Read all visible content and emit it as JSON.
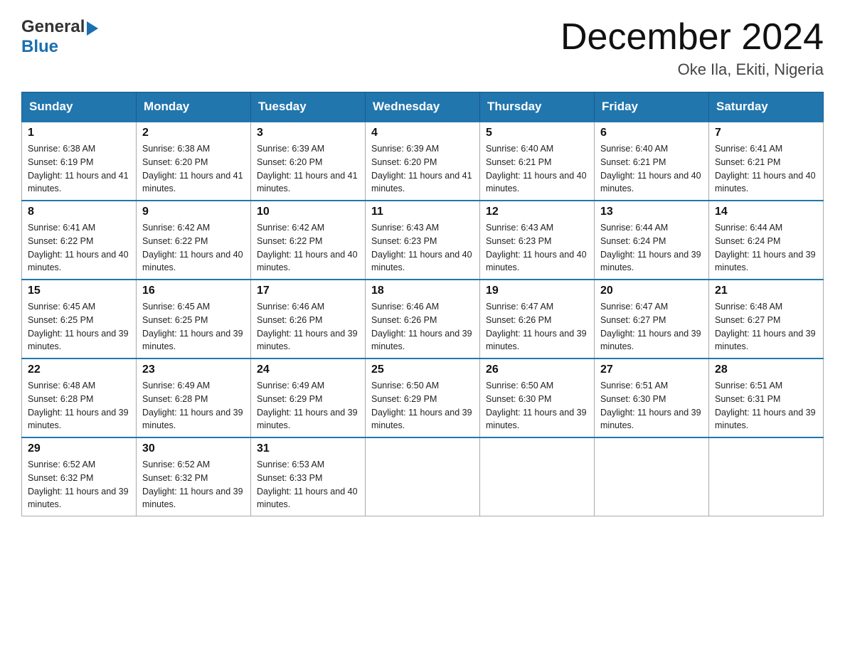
{
  "header": {
    "logo_line1": "General",
    "logo_arrow": "▶",
    "logo_line2": "Blue",
    "month_title": "December 2024",
    "location": "Oke Ila, Ekiti, Nigeria"
  },
  "calendar": {
    "days_of_week": [
      "Sunday",
      "Monday",
      "Tuesday",
      "Wednesday",
      "Thursday",
      "Friday",
      "Saturday"
    ],
    "weeks": [
      [
        {
          "day": "1",
          "sunrise": "6:38 AM",
          "sunset": "6:19 PM",
          "daylight": "11 hours and 41 minutes."
        },
        {
          "day": "2",
          "sunrise": "6:38 AM",
          "sunset": "6:20 PM",
          "daylight": "11 hours and 41 minutes."
        },
        {
          "day": "3",
          "sunrise": "6:39 AM",
          "sunset": "6:20 PM",
          "daylight": "11 hours and 41 minutes."
        },
        {
          "day": "4",
          "sunrise": "6:39 AM",
          "sunset": "6:20 PM",
          "daylight": "11 hours and 41 minutes."
        },
        {
          "day": "5",
          "sunrise": "6:40 AM",
          "sunset": "6:21 PM",
          "daylight": "11 hours and 40 minutes."
        },
        {
          "day": "6",
          "sunrise": "6:40 AM",
          "sunset": "6:21 PM",
          "daylight": "11 hours and 40 minutes."
        },
        {
          "day": "7",
          "sunrise": "6:41 AM",
          "sunset": "6:21 PM",
          "daylight": "11 hours and 40 minutes."
        }
      ],
      [
        {
          "day": "8",
          "sunrise": "6:41 AM",
          "sunset": "6:22 PM",
          "daylight": "11 hours and 40 minutes."
        },
        {
          "day": "9",
          "sunrise": "6:42 AM",
          "sunset": "6:22 PM",
          "daylight": "11 hours and 40 minutes."
        },
        {
          "day": "10",
          "sunrise": "6:42 AM",
          "sunset": "6:22 PM",
          "daylight": "11 hours and 40 minutes."
        },
        {
          "day": "11",
          "sunrise": "6:43 AM",
          "sunset": "6:23 PM",
          "daylight": "11 hours and 40 minutes."
        },
        {
          "day": "12",
          "sunrise": "6:43 AM",
          "sunset": "6:23 PM",
          "daylight": "11 hours and 40 minutes."
        },
        {
          "day": "13",
          "sunrise": "6:44 AM",
          "sunset": "6:24 PM",
          "daylight": "11 hours and 39 minutes."
        },
        {
          "day": "14",
          "sunrise": "6:44 AM",
          "sunset": "6:24 PM",
          "daylight": "11 hours and 39 minutes."
        }
      ],
      [
        {
          "day": "15",
          "sunrise": "6:45 AM",
          "sunset": "6:25 PM",
          "daylight": "11 hours and 39 minutes."
        },
        {
          "day": "16",
          "sunrise": "6:45 AM",
          "sunset": "6:25 PM",
          "daylight": "11 hours and 39 minutes."
        },
        {
          "day": "17",
          "sunrise": "6:46 AM",
          "sunset": "6:26 PM",
          "daylight": "11 hours and 39 minutes."
        },
        {
          "day": "18",
          "sunrise": "6:46 AM",
          "sunset": "6:26 PM",
          "daylight": "11 hours and 39 minutes."
        },
        {
          "day": "19",
          "sunrise": "6:47 AM",
          "sunset": "6:26 PM",
          "daylight": "11 hours and 39 minutes."
        },
        {
          "day": "20",
          "sunrise": "6:47 AM",
          "sunset": "6:27 PM",
          "daylight": "11 hours and 39 minutes."
        },
        {
          "day": "21",
          "sunrise": "6:48 AM",
          "sunset": "6:27 PM",
          "daylight": "11 hours and 39 minutes."
        }
      ],
      [
        {
          "day": "22",
          "sunrise": "6:48 AM",
          "sunset": "6:28 PM",
          "daylight": "11 hours and 39 minutes."
        },
        {
          "day": "23",
          "sunrise": "6:49 AM",
          "sunset": "6:28 PM",
          "daylight": "11 hours and 39 minutes."
        },
        {
          "day": "24",
          "sunrise": "6:49 AM",
          "sunset": "6:29 PM",
          "daylight": "11 hours and 39 minutes."
        },
        {
          "day": "25",
          "sunrise": "6:50 AM",
          "sunset": "6:29 PM",
          "daylight": "11 hours and 39 minutes."
        },
        {
          "day": "26",
          "sunrise": "6:50 AM",
          "sunset": "6:30 PM",
          "daylight": "11 hours and 39 minutes."
        },
        {
          "day": "27",
          "sunrise": "6:51 AM",
          "sunset": "6:30 PM",
          "daylight": "11 hours and 39 minutes."
        },
        {
          "day": "28",
          "sunrise": "6:51 AM",
          "sunset": "6:31 PM",
          "daylight": "11 hours and 39 minutes."
        }
      ],
      [
        {
          "day": "29",
          "sunrise": "6:52 AM",
          "sunset": "6:32 PM",
          "daylight": "11 hours and 39 minutes."
        },
        {
          "day": "30",
          "sunrise": "6:52 AM",
          "sunset": "6:32 PM",
          "daylight": "11 hours and 39 minutes."
        },
        {
          "day": "31",
          "sunrise": "6:53 AM",
          "sunset": "6:33 PM",
          "daylight": "11 hours and 40 minutes."
        },
        null,
        null,
        null,
        null
      ]
    ]
  }
}
